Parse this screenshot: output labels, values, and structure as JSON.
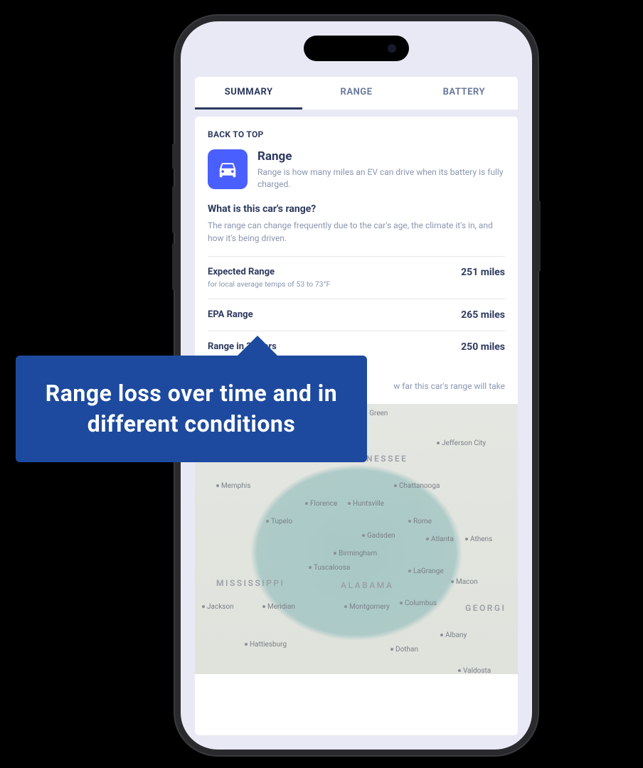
{
  "tabs": {
    "summary": "SUMMARY",
    "range": "RANGE",
    "battery": "BATTERY"
  },
  "back_to_top": "BACK TO TOP",
  "header": {
    "title": "Range",
    "subtitle": "Range is how many miles an EV can drive when its battery is fully charged."
  },
  "question": "What is this car's range?",
  "answer": "The range can change frequently due to the car's age, the climate it's in, and how it's being driven.",
  "stats": {
    "expected": {
      "label": "Expected Range",
      "sublabel": "for local average temps of 53 to 73°F",
      "value": "251 miles"
    },
    "epa": {
      "label": "EPA Range",
      "value": "265 miles"
    },
    "three_year": {
      "label": "Range in 3 years",
      "value": "250 miles"
    }
  },
  "map_desc_fragment": "w far this car's range will take",
  "callout_text": "Range loss over time and in different conditions",
  "map": {
    "states": {
      "tennessee": "NNESSEE",
      "mississippi": "MISSISSIPPI",
      "alabama": "ALABAMA",
      "georgia": "GEORGI"
    },
    "cities": {
      "bowling_green": "g Green",
      "jefferson_city": "Jefferson City",
      "memphis": "Memphis",
      "chattanooga": "Chattanooga",
      "florence": "Florence",
      "huntsville": "Huntsville",
      "tupelo": "Tupelo",
      "rome": "Rome",
      "gadsden": "Gadsden",
      "atlanta": "Atlanta",
      "athens": "Athens",
      "birmingham": "Birmingham",
      "tuscaloosa": "Tuscaloosa",
      "lagrange": "LaGrange",
      "macon": "Macon",
      "columbus": "Columbus",
      "jackson": "Jackson",
      "meridian": "Meridian",
      "montgomery": "Montgomery",
      "albany": "Albany",
      "hattiesburg": "Hattiesburg",
      "dothan": "Dothan",
      "valdosta": "Valdosta"
    }
  }
}
